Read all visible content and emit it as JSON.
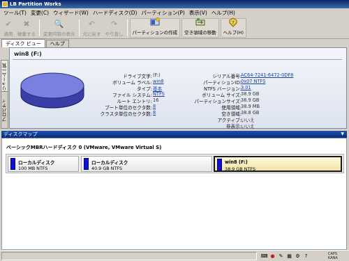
{
  "window": {
    "title": "LB Partition Works"
  },
  "menu": [
    "ツール(T)",
    "変更(C)",
    "ウィザード(W)",
    "ハードディスク(D)",
    "パーティション(P)",
    "表示(V)",
    "ヘルプ(H)"
  ],
  "toolbar": {
    "apply": "適用",
    "discard": "破棄する",
    "show_changes": "変更内容の表示",
    "undo": "元に戻す",
    "redo": "やり直し",
    "create_partition": "パーティションの作成",
    "move_free_space": "空き領域の移動",
    "help": "ヘルプ(H)"
  },
  "tabs": {
    "disk_view": "ディスク ビュー",
    "help": "ヘルプ"
  },
  "side_tabs": {
    "volume_list": "ボリューム一覧",
    "properties": "プロパティ"
  },
  "volume": {
    "title": "win8 (F:)",
    "left_labels": [
      "ドライブ文字:",
      "ボリューム ラベル:",
      "タイプ:",
      "ファイル システム:",
      "ルート エントリ:",
      "ブート単位のセクタ数:",
      "クラスタ単位のセクタ数:"
    ],
    "left_values": [
      "(F:)",
      "win8",
      "基本",
      "NTFS",
      "16",
      "8",
      "8"
    ],
    "right_labels": [
      "シリアル番号:",
      "パーティションID:",
      "NTFS バージョン:",
      "ボリューム サイズ:",
      "パーティションサイズ:",
      "使用領域:",
      "空き領域:",
      "アクティブ:",
      "非表示:"
    ],
    "right_values": [
      "AC64-7241-6472-0DF8",
      "0x07 NTFS",
      "3.01",
      "38.9 GB",
      "38.9 GB",
      "38.9 MB",
      "38.8 GB",
      "いいえ",
      "いいえ"
    ]
  },
  "disk_map": {
    "header": "ディスクマップ",
    "disk_label": "ベーシックMBRハードディスク 0 (VMware, VMware Virtual S)",
    "partitions": [
      {
        "name": "ローカルディスク",
        "size": "100 MB NTFS"
      },
      {
        "name": "ローカルディスク",
        "size": "40.9 GB NTFS"
      },
      {
        "name": "win8 (F:)",
        "size": "38.9 GB NTFS"
      }
    ]
  },
  "statusbar": {
    "indicator": "CAPS KANA"
  },
  "colors": {
    "title_bar": "#0a246a",
    "partition_bar": "#1010d0",
    "disk_map_header": "#1d4fb0"
  }
}
